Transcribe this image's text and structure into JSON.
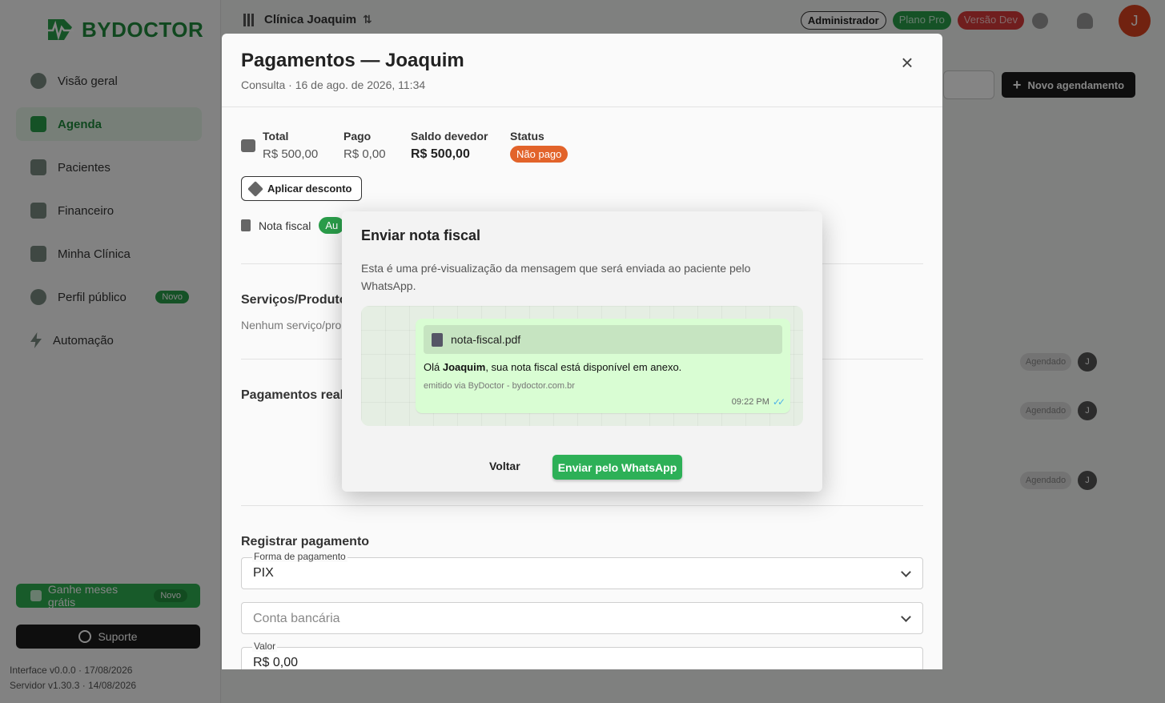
{
  "brand": {
    "name": "BYDOCTOR",
    "color": "#1f8a3c"
  },
  "sidebar": {
    "items": [
      {
        "label": "Visão geral",
        "icon": "chart-pie-icon"
      },
      {
        "label": "Agenda",
        "icon": "calendar-icon",
        "active": true
      },
      {
        "label": "Pacientes",
        "icon": "id-card-icon"
      },
      {
        "label": "Financeiro",
        "icon": "briefcase-icon"
      },
      {
        "label": "Minha Clínica",
        "icon": "building-icon"
      },
      {
        "label": "Perfil público",
        "icon": "globe-icon",
        "badge": "Novo"
      },
      {
        "label": "Automação",
        "icon": "bolt-icon"
      }
    ],
    "promo": {
      "label": "Ganhe meses grátis",
      "badge": "Novo"
    },
    "support": "Suporte",
    "version_interface": "Interface v0.0.0 · 17/08/2026",
    "version_server": "Servidor v1.30.3 · 14/08/2026"
  },
  "topbar": {
    "clinic": "Clínica Joaquim",
    "badge_admin": "Administrador",
    "badge_plan": "Plano Pro",
    "badge_version": "Versão Dev",
    "avatar": "J",
    "new_appointment": "Novo agendamento"
  },
  "background_rows": [
    {
      "status": "Agendado",
      "avatar": "J"
    },
    {
      "status": "Agendado",
      "avatar": "J"
    },
    {
      "status": "Agendado",
      "avatar": "J"
    }
  ],
  "payments_modal": {
    "title": "Pagamentos — Joaquim",
    "subtitle": "Consulta · 16 de ago. de 2026, 11:34",
    "total_label": "Total",
    "total_value": "R$ 500,00",
    "paid_label": "Pago",
    "paid_value": "R$ 0,00",
    "balance_label": "Saldo devedor",
    "balance_value": "R$ 500,00",
    "status_label": "Status",
    "status_value": "Não pago",
    "discount_button": "Aplicar desconto",
    "invoice_label": "Nota fiscal",
    "invoice_status_partial": "Au",
    "services_title_partial": "Serviços/Produtos",
    "services_empty_partial": "Nenhum serviço/pro",
    "payments_title_partial": "Pagamentos real",
    "register_title": "Registrar pagamento",
    "method_label": "Forma de pagamento",
    "method_value": "PIX",
    "account_placeholder": "Conta bancária",
    "amount_label": "Valor",
    "amount_value": "R$ 0,00"
  },
  "dialog": {
    "title": "Enviar nota fiscal",
    "description": "Esta é uma pré-visualização da mensagem que será enviada ao paciente pelo WhatsApp.",
    "attachment": "nota-fiscal.pdf",
    "message_prefix": "Olá ",
    "message_name": "Joaquim",
    "message_suffix": ", sua nota fiscal está disponível em anexo.",
    "message_footer": "emitido via ByDoctor - bydoctor.com.br",
    "message_time": "09:22 PM",
    "back_button": "Voltar",
    "send_button": "Enviar pelo WhatsApp"
  }
}
